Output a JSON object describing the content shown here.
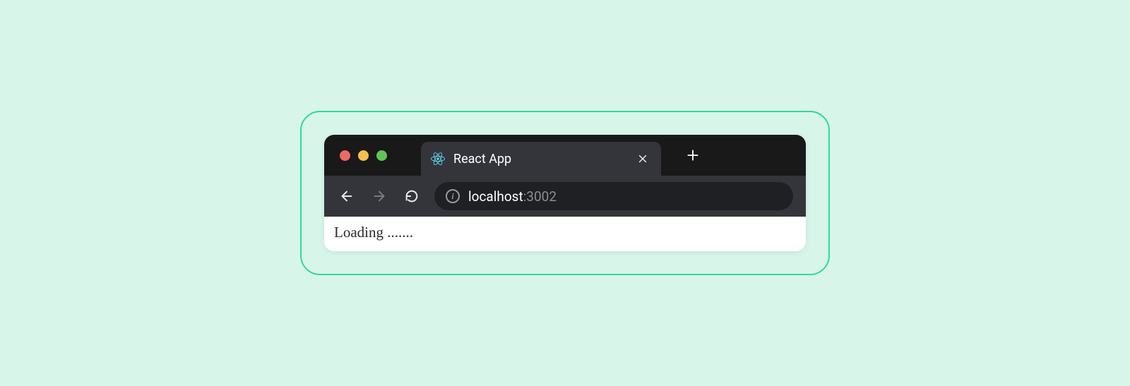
{
  "tab": {
    "title": "React App",
    "favicon": "react-icon"
  },
  "url": {
    "host": "localhost",
    "port": ":3002"
  },
  "page": {
    "loading_text": "Loading ......."
  },
  "colors": {
    "frame_border": "#2cdb9a",
    "background": "#d8f5ea",
    "titlebar": "#19191a",
    "toolbar": "#34353a",
    "address_bar": "#1f2023"
  }
}
